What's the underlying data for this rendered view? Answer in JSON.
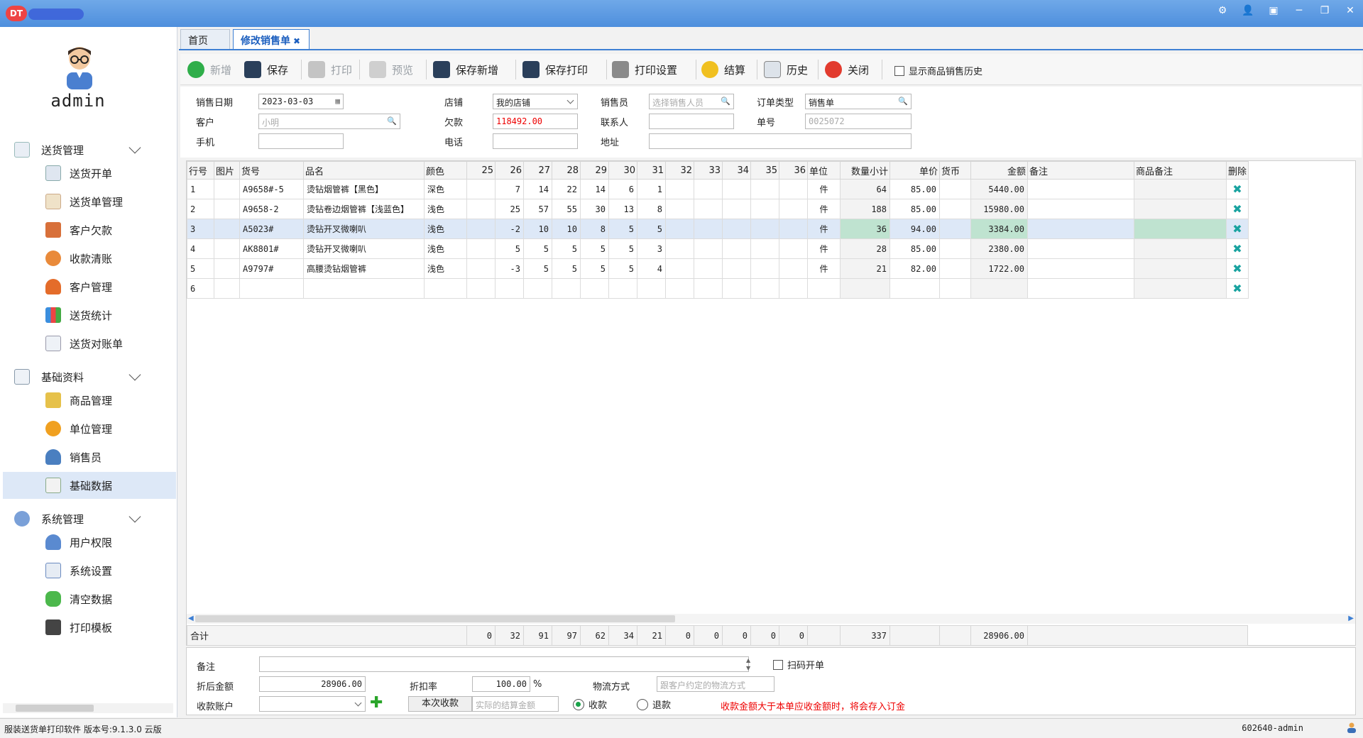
{
  "window": {
    "logo": "DT"
  },
  "user": {
    "name": "admin"
  },
  "sidebar": {
    "groups": [
      {
        "label": "送货管理",
        "items": [
          "送货开单",
          "送货单管理",
          "客户欠款",
          "收款清账",
          "客户管理",
          "送货统计",
          "送货对账单"
        ]
      },
      {
        "label": "基础资料",
        "items": [
          "商品管理",
          "单位管理",
          "销售员",
          "基础数据"
        ]
      },
      {
        "label": "系统管理",
        "items": [
          "用户权限",
          "系统设置",
          "清空数据",
          "打印模板"
        ]
      }
    ],
    "active_item": "基础数据"
  },
  "tabs": [
    {
      "label": "首页"
    },
    {
      "label": "修改销售单",
      "close": "✖"
    }
  ],
  "toolbar": {
    "new": "新增",
    "save": "保存",
    "print": "打印",
    "preview": "预览",
    "save_new": "保存新增",
    "save_print": "保存打印",
    "print_settings": "打印设置",
    "settle": "结算",
    "history": "历史",
    "close": "关闭",
    "show_history": "显示商品销售历史"
  },
  "form": {
    "sale_date": {
      "label": "销售日期",
      "value": "2023-03-03"
    },
    "shop": {
      "label": "店铺",
      "value": "我的店铺"
    },
    "salesman": {
      "label": "销售员",
      "placeholder": "选择销售人员"
    },
    "order_type": {
      "label": "订单类型",
      "value": "销售单"
    },
    "customer": {
      "label": "客户",
      "value": "小明"
    },
    "debt": {
      "label": "欠款",
      "value": "118492.00"
    },
    "contact": {
      "label": "联系人",
      "value": ""
    },
    "order_no": {
      "label": "单号",
      "value": "0025072"
    },
    "mobile": {
      "label": "手机",
      "value": ""
    },
    "phone": {
      "label": "电话",
      "value": ""
    },
    "address": {
      "label": "地址",
      "value": ""
    }
  },
  "grid": {
    "headers": [
      "行号",
      "图片",
      "货号",
      "品名",
      "颜色",
      "25",
      "26",
      "27",
      "28",
      "29",
      "30",
      "31",
      "32",
      "33",
      "34",
      "35",
      "36",
      "单位",
      "数量小计",
      "单价",
      "货币",
      "金额",
      "备注",
      "商品备注",
      "删除"
    ],
    "rows": [
      {
        "no": "1",
        "code": "A9658#-5",
        "name": "烫钻烟管裤【黑色】",
        "color": "深色",
        "sizes": [
          "",
          "7",
          "14",
          "22",
          "14",
          "6",
          "1",
          "",
          "",
          "",
          "",
          ""
        ],
        "unit": "件",
        "qty": "64",
        "price": "85.00",
        "currency": "",
        "amount": "5440.00"
      },
      {
        "no": "2",
        "code": "A9658-2",
        "name": "烫钻卷边烟管裤【浅蓝色】",
        "color": "浅色",
        "sizes": [
          "",
          "25",
          "57",
          "55",
          "30",
          "13",
          "8",
          "",
          "",
          "",
          "",
          ""
        ],
        "unit": "件",
        "qty": "188",
        "price": "85.00",
        "currency": "",
        "amount": "15980.00"
      },
      {
        "no": "3",
        "code": "A5023#",
        "name": "烫钻开叉微喇叭",
        "color": "浅色",
        "sizes": [
          "",
          "-2",
          "10",
          "10",
          "8",
          "5",
          "5",
          "",
          "",
          "",
          "",
          ""
        ],
        "unit": "件",
        "qty": "36",
        "price": "94.00",
        "currency": "",
        "amount": "3384.00"
      },
      {
        "no": "4",
        "code": "AK8801#",
        "name": "烫钻开叉微喇叭",
        "color": "浅色",
        "sizes": [
          "",
          "5",
          "5",
          "5",
          "5",
          "5",
          "3",
          "",
          "",
          "",
          "",
          ""
        ],
        "unit": "件",
        "qty": "28",
        "price": "85.00",
        "currency": "",
        "amount": "2380.00"
      },
      {
        "no": "5",
        "code": "A9797#",
        "name": "高腰烫钻烟管裤",
        "color": "浅色",
        "sizes": [
          "",
          "-3",
          "5",
          "5",
          "5",
          "5",
          "4",
          "",
          "",
          "",
          "",
          ""
        ],
        "unit": "件",
        "qty": "21",
        "price": "82.00",
        "currency": "",
        "amount": "1722.00"
      },
      {
        "no": "6",
        "code": "",
        "name": "",
        "color": "",
        "sizes": [
          "",
          "",
          "",
          "",
          "",
          "",
          "",
          "",
          "",
          "",
          "",
          ""
        ],
        "unit": "",
        "qty": "",
        "price": "",
        "currency": "",
        "amount": ""
      }
    ],
    "selected_row": 3,
    "totals": {
      "label": "合计",
      "sizes": [
        "0",
        "32",
        "91",
        "97",
        "62",
        "34",
        "21",
        "0",
        "0",
        "0",
        "0",
        "0"
      ],
      "qty": "337",
      "amount": "28906.00"
    }
  },
  "bottom": {
    "remark": {
      "label": "备注",
      "value": ""
    },
    "scan": "扫码开单",
    "discounted_amount": {
      "label": "折后金额",
      "value": "28906.00"
    },
    "discount_rate": {
      "label": "折扣率",
      "value": "100.00",
      "unit": "%"
    },
    "logistics": {
      "label": "物流方式",
      "placeholder": "跟客户约定的物流方式"
    },
    "account": {
      "label": "收款账户",
      "value": ""
    },
    "receive_now": "本次收款",
    "settle_placeholder": "实际的结算金额",
    "radio_receive": "收款",
    "radio_refund": "退款",
    "warning": "收款金额大于本单应收金额时，将会存入订金"
  },
  "status": {
    "left": "服装送货单打印软件 版本号:9.1.3.0 云版",
    "right": "602640-admin"
  },
  "colors": {
    "accent": "#3d7fd4",
    "titlebar": "#5b9ae3",
    "warning": "#e00000",
    "delete": "#19a3a0"
  }
}
